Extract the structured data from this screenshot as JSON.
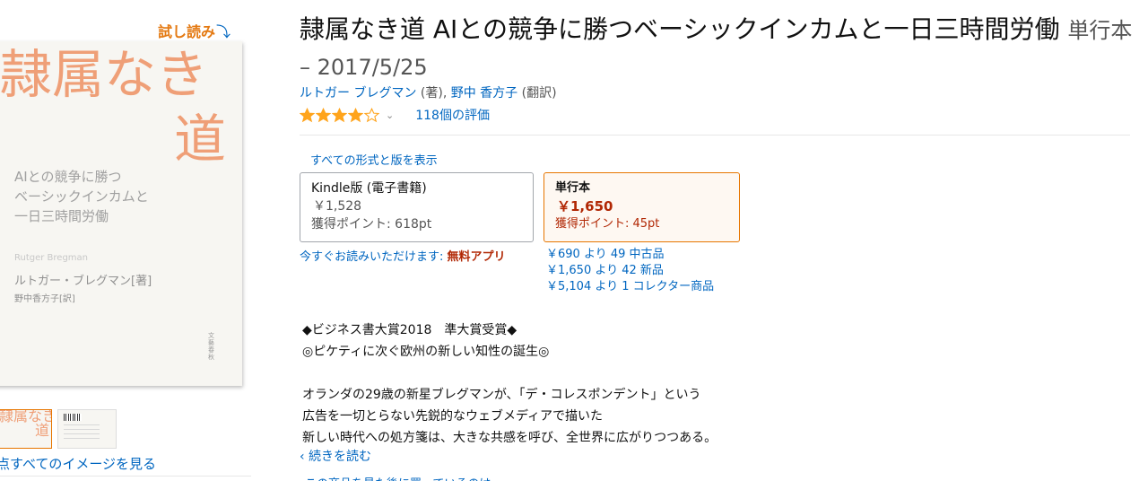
{
  "left": {
    "trial_read": "試し読み",
    "trial_arrow": "⤵",
    "cover": {
      "title_line1": "隷属なき",
      "title_line2": "道",
      "subtitle": "AIとの競争に勝つ\nベーシックインカムと\n一日三時間労働",
      "author_en": "Rutger Bregman",
      "author": "ルトガー・ブレグマン[著]",
      "translator": "野中香方子[訳]",
      "publisher": "文藝春秋"
    },
    "thumb_title1": "隷属なき",
    "thumb_title2": "道",
    "see_all_images": "点すべてのイメージを見る"
  },
  "product": {
    "title": "隷属なき道 AIとの競争に勝つベーシックインカムと一日三時間労働",
    "format_date": "単行本 – 2017/5/25",
    "author_name": "ルトガー ブレグマン",
    "author_role": "(著),",
    "translator_name": "野中 香方子",
    "translator_role": "(翻訳)",
    "stars": 4,
    "star_color": "#ffa41c",
    "rating_chevron": "⌄",
    "rating_count": "118個の評価"
  },
  "formats": {
    "all_formats_link": "すべての形式と版を表示",
    "kindle": {
      "name": "Kindle版 (電子書籍)",
      "price": "￥1,528",
      "points": "獲得ポイント: 618pt"
    },
    "hardcover": {
      "name": "単行本",
      "price": "￥1,650",
      "points": "獲得ポイント: 45pt"
    },
    "free_app_prefix": "今すぐお読みいただけます:",
    "free_app_label": "無料アプリ",
    "offers": [
      "￥690 より 49 中古品",
      "￥1,650 より 42 新品",
      "￥5,104 より 1 コレクター商品"
    ]
  },
  "description": {
    "line1": "◆ビジネス書大賞2018　準大賞受賞◆",
    "line2": "◎ピケティに次ぐ欧州の新しい知性の誕生◎",
    "line3": "オランダの29歳の新星ブレグマンが、「デ・コレスポンデント」という",
    "line4": "広告を一切とらない先鋭的なウェブメディアで描いた",
    "line5": "新しい時代への処方箋は、大きな共感を呼び、全世界に広がりつつある。",
    "read_more": "‹ 続きを読む",
    "cut_text": "この商品を見た後に買っているのは"
  }
}
